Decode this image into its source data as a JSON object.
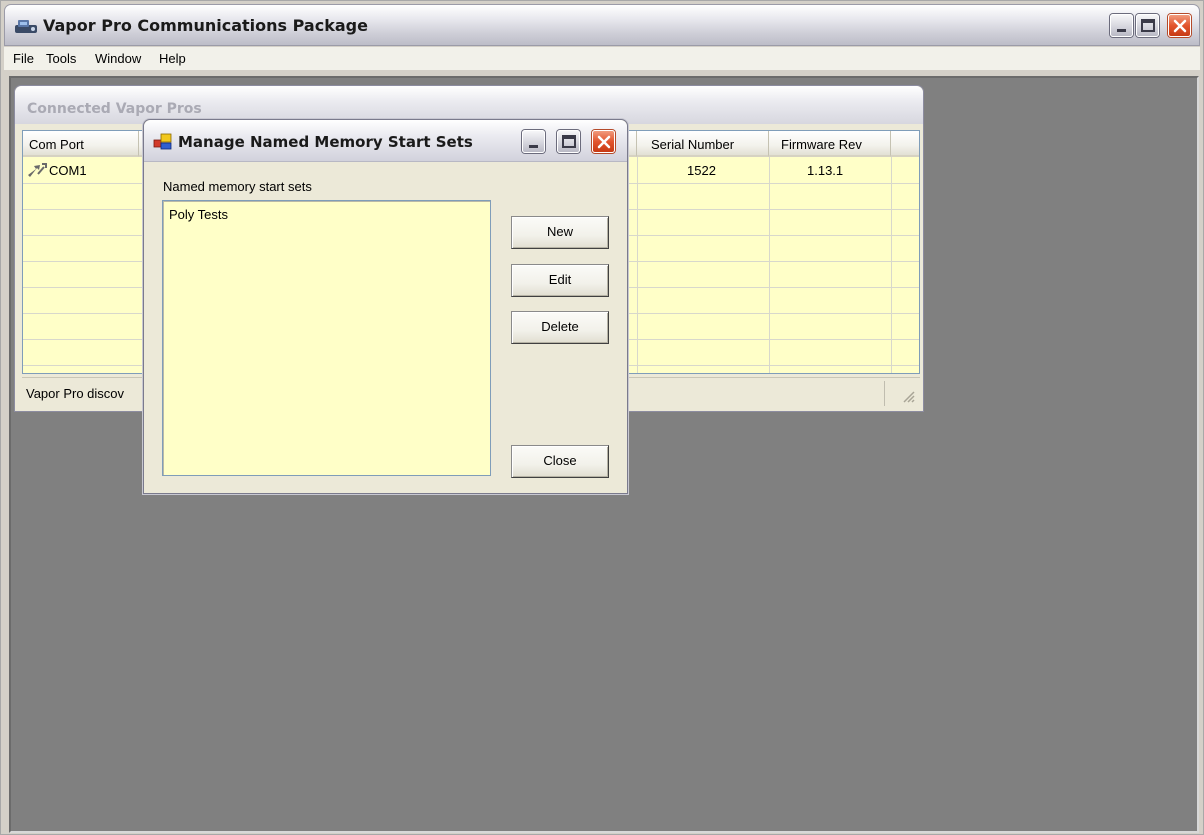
{
  "app": {
    "title": "Vapor Pro Communications Package",
    "icon": "app-device-icon"
  },
  "menu": {
    "items": [
      "File",
      "Tools",
      "Window",
      "Help"
    ]
  },
  "connected_window": {
    "title": "Connected Vapor Pros",
    "columns": [
      "Com Port",
      "Serial Number",
      "Firmware Rev"
    ],
    "rows": [
      {
        "com_port": "COM1",
        "serial_number": "1522",
        "firmware_rev": "1.13.1"
      }
    ],
    "status_text": "Vapor Pro discov"
  },
  "dialog": {
    "title": "Manage Named Memory Start Sets",
    "list_label": "Named memory start sets",
    "list_items": [
      "Poly Tests"
    ],
    "buttons": {
      "new": "New",
      "edit": "Edit",
      "delete": "Delete",
      "close": "Close"
    }
  },
  "colors": {
    "accent_blue": "#2650d4",
    "close_red": "#c73a14",
    "grid_background": "#ffffc8",
    "mdi_background": "#808080"
  }
}
